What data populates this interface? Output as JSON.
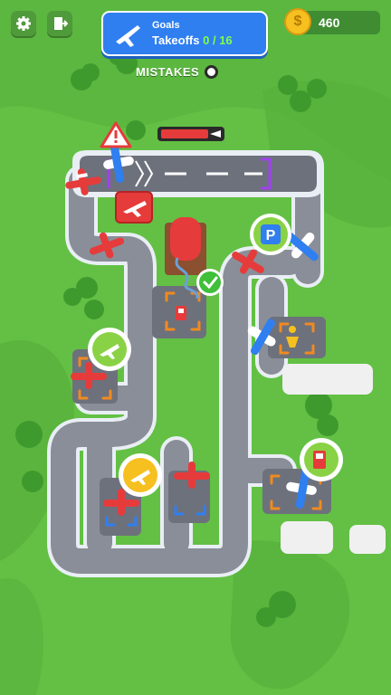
{
  "hud": {
    "settings_icon": "gear-icon",
    "exit_icon": "exit-door-icon",
    "goals_title": "Goals",
    "goals_label": "Takeoffs",
    "goals_progress": "0 / 16",
    "coins": "460",
    "coin_symbol": "$",
    "mistakes_label": "MISTAKES"
  },
  "map": {
    "warning_icon": "warning-triangle-icon",
    "takeoff_sign_icon": "departure-plane-icon",
    "runway_arrow_icon": "takeoff-arrow-icon",
    "fuel_tank": "fuel-tank",
    "stations": [
      {
        "name": "parking-station",
        "icon": "P",
        "badge_color": "#2f7ff0"
      },
      {
        "name": "fuel-station",
        "icon": "fuel-pump-icon",
        "badge_color": "#e63b3b"
      },
      {
        "name": "refuel-pad-top",
        "icon": "fuel-pump-icon",
        "badge_color": "#e63b3b"
      },
      {
        "name": "passenger-station",
        "icon": "person-icon",
        "badge_color": "#f5c020"
      },
      {
        "name": "departure-bubble-left",
        "icon": "plane-icon",
        "badge_color": "#8ad245"
      },
      {
        "name": "departure-bubble-bottom",
        "icon": "plane-icon",
        "badge_color": "#f5c020"
      }
    ],
    "ready_check_icon": "check-icon",
    "colors": {
      "grass": "#63c044",
      "grass_dark": "#4fa33a",
      "road": "#8a8e99",
      "road_border": "#e9eef5",
      "plane_red": "#e63b3b",
      "plane_blue": "#2f7ff0",
      "fuel_red": "#e63b3b",
      "ui_blue": "#2f7ff0",
      "coin": "#f5c020"
    }
  }
}
